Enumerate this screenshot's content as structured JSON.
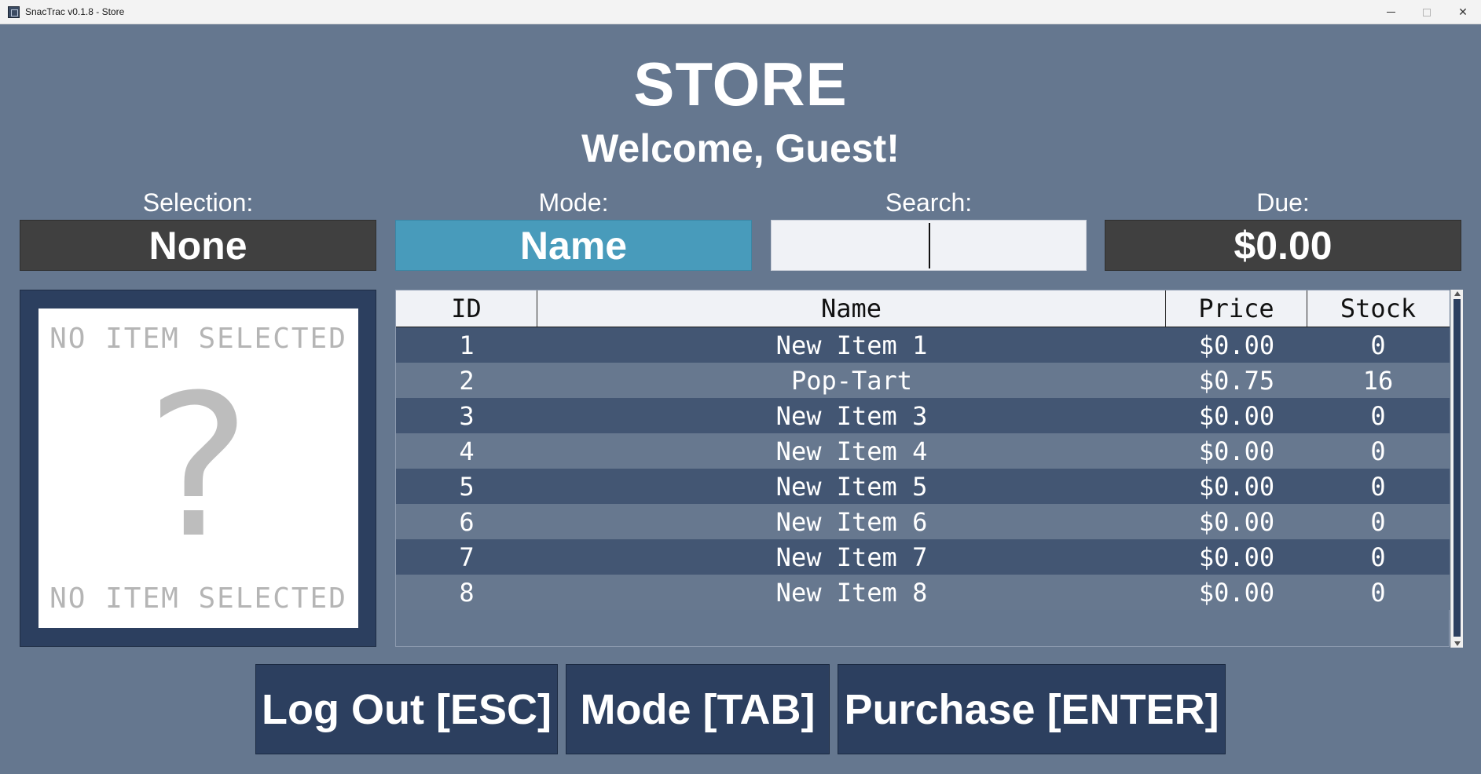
{
  "window": {
    "title": "SnacTrac v0.1.8 - Store"
  },
  "header": {
    "title": "STORE",
    "welcome": "Welcome, Guest!"
  },
  "fields": {
    "selection": {
      "label": "Selection:",
      "value": "None"
    },
    "mode": {
      "label": "Mode:",
      "value": "Name"
    },
    "search": {
      "label": "Search:",
      "value": ""
    },
    "due": {
      "label": "Due:",
      "value": "$0.00"
    }
  },
  "preview": {
    "top_text": "NO ITEM SELECTED",
    "bottom_text": "NO ITEM SELECTED",
    "placeholder_glyph": "?"
  },
  "table": {
    "columns": [
      "ID",
      "Name",
      "Price",
      "Stock"
    ],
    "rows": [
      [
        "1",
        "New Item 1",
        "$0.00",
        "0"
      ],
      [
        "2",
        "Pop-Tart",
        "$0.75",
        "16"
      ],
      [
        "3",
        "New Item 3",
        "$0.00",
        "0"
      ],
      [
        "4",
        "New Item 4",
        "$0.00",
        "0"
      ],
      [
        "5",
        "New Item 5",
        "$0.00",
        "0"
      ],
      [
        "6",
        "New Item 6",
        "$0.00",
        "0"
      ],
      [
        "7",
        "New Item 7",
        "$0.00",
        "0"
      ],
      [
        "8",
        "New Item 8",
        "$0.00",
        "0"
      ]
    ]
  },
  "buttons": {
    "logout": "Log Out [ESC]",
    "mode": "Mode [TAB]",
    "purchase": "Purchase [ENTER]"
  },
  "colors": {
    "background": "#65778f",
    "panel_dark": "#404040",
    "mode_accent": "#489bbb",
    "navy": "#2c3f5f",
    "row_dark": "#435673",
    "row_light": "#67788f"
  }
}
